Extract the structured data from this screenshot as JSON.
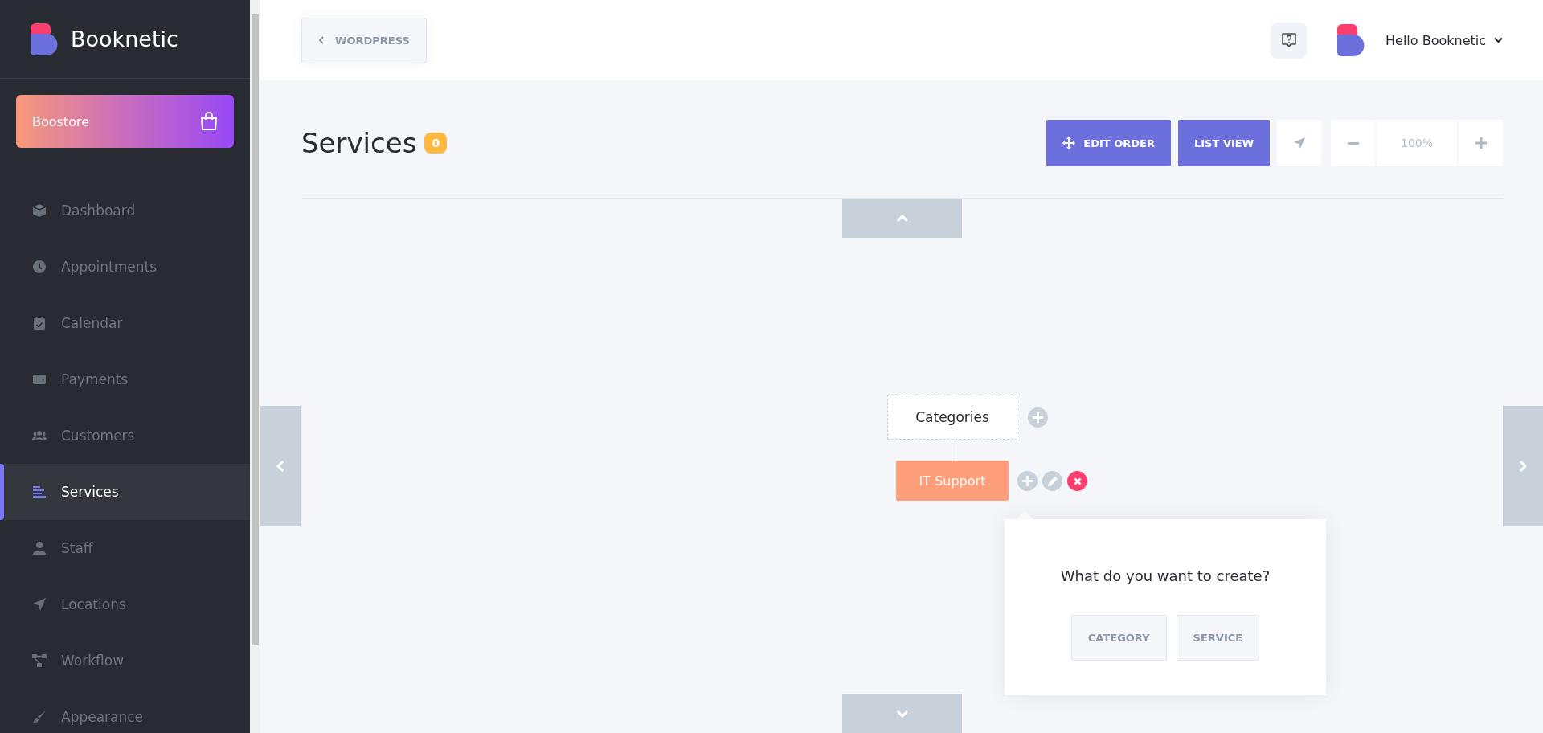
{
  "brand": {
    "name": "Booknetic"
  },
  "boostore": {
    "label": "Boostore"
  },
  "sidebar": {
    "items": [
      {
        "label": "Dashboard",
        "kind": "cube",
        "selected": false
      },
      {
        "label": "Appointments",
        "kind": "clock",
        "selected": false
      },
      {
        "label": "Calendar",
        "kind": "calendar",
        "selected": false
      },
      {
        "label": "Payments",
        "kind": "wallet",
        "selected": false
      },
      {
        "label": "Customers",
        "kind": "users",
        "selected": false
      },
      {
        "label": "Services",
        "kind": "lines",
        "selected": true
      },
      {
        "label": "Staff",
        "kind": "user",
        "selected": false
      },
      {
        "label": "Locations",
        "kind": "arrow",
        "selected": false
      },
      {
        "label": "Workflow",
        "kind": "workflow",
        "selected": false
      },
      {
        "label": "Appearance",
        "kind": "brush",
        "selected": false
      }
    ]
  },
  "topbar": {
    "back_button": "WORDPRESS",
    "user": "Hello Booknetic"
  },
  "page": {
    "title": "Services",
    "count": "0"
  },
  "toolbar": {
    "edit_order": "EDIT ORDER",
    "list_view": "LIST VIEW",
    "zoom": "100%"
  },
  "tree": {
    "root": {
      "label": "Categories",
      "children": [
        {
          "label": "IT Support"
        }
      ]
    }
  },
  "popup": {
    "question": "What do you want to create?",
    "options": [
      "CATEGORY",
      "SERVICE"
    ]
  }
}
